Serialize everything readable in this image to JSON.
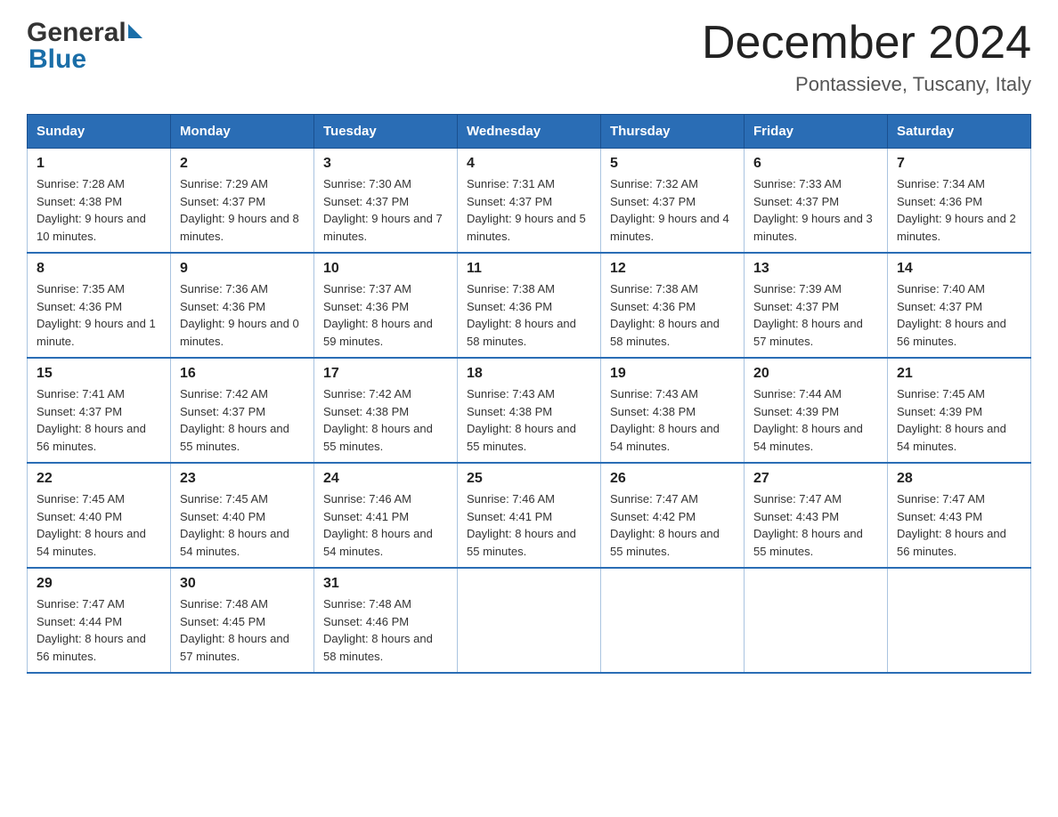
{
  "header": {
    "logo_general": "General",
    "logo_blue": "Blue",
    "month_title": "December 2024",
    "location": "Pontassieve, Tuscany, Italy"
  },
  "days_of_week": [
    "Sunday",
    "Monday",
    "Tuesday",
    "Wednesday",
    "Thursday",
    "Friday",
    "Saturday"
  ],
  "weeks": [
    [
      {
        "day": "1",
        "sunrise": "7:28 AM",
        "sunset": "4:38 PM",
        "daylight": "9 hours and 10 minutes."
      },
      {
        "day": "2",
        "sunrise": "7:29 AM",
        "sunset": "4:37 PM",
        "daylight": "9 hours and 8 minutes."
      },
      {
        "day": "3",
        "sunrise": "7:30 AM",
        "sunset": "4:37 PM",
        "daylight": "9 hours and 7 minutes."
      },
      {
        "day": "4",
        "sunrise": "7:31 AM",
        "sunset": "4:37 PM",
        "daylight": "9 hours and 5 minutes."
      },
      {
        "day": "5",
        "sunrise": "7:32 AM",
        "sunset": "4:37 PM",
        "daylight": "9 hours and 4 minutes."
      },
      {
        "day": "6",
        "sunrise": "7:33 AM",
        "sunset": "4:37 PM",
        "daylight": "9 hours and 3 minutes."
      },
      {
        "day": "7",
        "sunrise": "7:34 AM",
        "sunset": "4:36 PM",
        "daylight": "9 hours and 2 minutes."
      }
    ],
    [
      {
        "day": "8",
        "sunrise": "7:35 AM",
        "sunset": "4:36 PM",
        "daylight": "9 hours and 1 minute."
      },
      {
        "day": "9",
        "sunrise": "7:36 AM",
        "sunset": "4:36 PM",
        "daylight": "9 hours and 0 minutes."
      },
      {
        "day": "10",
        "sunrise": "7:37 AM",
        "sunset": "4:36 PM",
        "daylight": "8 hours and 59 minutes."
      },
      {
        "day": "11",
        "sunrise": "7:38 AM",
        "sunset": "4:36 PM",
        "daylight": "8 hours and 58 minutes."
      },
      {
        "day": "12",
        "sunrise": "7:38 AM",
        "sunset": "4:36 PM",
        "daylight": "8 hours and 58 minutes."
      },
      {
        "day": "13",
        "sunrise": "7:39 AM",
        "sunset": "4:37 PM",
        "daylight": "8 hours and 57 minutes."
      },
      {
        "day": "14",
        "sunrise": "7:40 AM",
        "sunset": "4:37 PM",
        "daylight": "8 hours and 56 minutes."
      }
    ],
    [
      {
        "day": "15",
        "sunrise": "7:41 AM",
        "sunset": "4:37 PM",
        "daylight": "8 hours and 56 minutes."
      },
      {
        "day": "16",
        "sunrise": "7:42 AM",
        "sunset": "4:37 PM",
        "daylight": "8 hours and 55 minutes."
      },
      {
        "day": "17",
        "sunrise": "7:42 AM",
        "sunset": "4:38 PM",
        "daylight": "8 hours and 55 minutes."
      },
      {
        "day": "18",
        "sunrise": "7:43 AM",
        "sunset": "4:38 PM",
        "daylight": "8 hours and 55 minutes."
      },
      {
        "day": "19",
        "sunrise": "7:43 AM",
        "sunset": "4:38 PM",
        "daylight": "8 hours and 54 minutes."
      },
      {
        "day": "20",
        "sunrise": "7:44 AM",
        "sunset": "4:39 PM",
        "daylight": "8 hours and 54 minutes."
      },
      {
        "day": "21",
        "sunrise": "7:45 AM",
        "sunset": "4:39 PM",
        "daylight": "8 hours and 54 minutes."
      }
    ],
    [
      {
        "day": "22",
        "sunrise": "7:45 AM",
        "sunset": "4:40 PM",
        "daylight": "8 hours and 54 minutes."
      },
      {
        "day": "23",
        "sunrise": "7:45 AM",
        "sunset": "4:40 PM",
        "daylight": "8 hours and 54 minutes."
      },
      {
        "day": "24",
        "sunrise": "7:46 AM",
        "sunset": "4:41 PM",
        "daylight": "8 hours and 54 minutes."
      },
      {
        "day": "25",
        "sunrise": "7:46 AM",
        "sunset": "4:41 PM",
        "daylight": "8 hours and 55 minutes."
      },
      {
        "day": "26",
        "sunrise": "7:47 AM",
        "sunset": "4:42 PM",
        "daylight": "8 hours and 55 minutes."
      },
      {
        "day": "27",
        "sunrise": "7:47 AM",
        "sunset": "4:43 PM",
        "daylight": "8 hours and 55 minutes."
      },
      {
        "day": "28",
        "sunrise": "7:47 AM",
        "sunset": "4:43 PM",
        "daylight": "8 hours and 56 minutes."
      }
    ],
    [
      {
        "day": "29",
        "sunrise": "7:47 AM",
        "sunset": "4:44 PM",
        "daylight": "8 hours and 56 minutes."
      },
      {
        "day": "30",
        "sunrise": "7:48 AM",
        "sunset": "4:45 PM",
        "daylight": "8 hours and 57 minutes."
      },
      {
        "day": "31",
        "sunrise": "7:48 AM",
        "sunset": "4:46 PM",
        "daylight": "8 hours and 58 minutes."
      },
      null,
      null,
      null,
      null
    ]
  ]
}
